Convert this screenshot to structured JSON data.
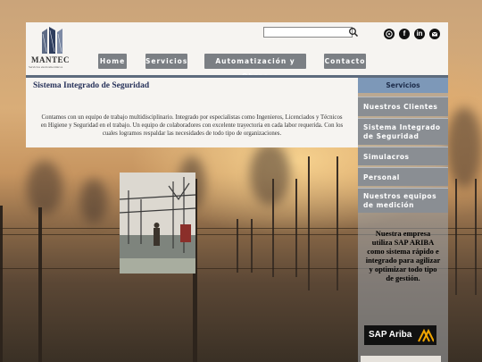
{
  "brand": {
    "name": "MANTEC",
    "tagline": "Servicios electromecánicos"
  },
  "search": {
    "placeholder": "",
    "value": ""
  },
  "social": [
    "whatsapp-icon",
    "facebook-icon",
    "linkedin-icon",
    "mail-icon"
  ],
  "nav": {
    "home": "Home",
    "services": "Servicios",
    "automation": "Automatización y Obras",
    "contact": "Contacto"
  },
  "main": {
    "title": "Sistema Integrado de Seguridad",
    "body": "Contamos con un equipo de trabajo multidisciplinario. Integrado por especialistas como Ingenieros, Licenciados y Técnicos en Higiene y Seguridad en el trabajo. Un equipo de colaboradores con excelente trayectoria en cada labor requerida. Con los cuales logramos respaldar las necesidades de todo tipo de organizaciones."
  },
  "sidebar": {
    "heading": "Servicios",
    "items": [
      "Nuestros Clientes",
      "Sistema Integrado de Seguridad",
      "Simulacros",
      "Personal Capacitado",
      "Nuestros equipos de medición"
    ],
    "promo": "Nuestra empresa utiliza SAP ARIBA como sistema rápido e integrado para agilizar y optimizar todo tipo de gestión.",
    "badge": "SAP Ariba"
  },
  "colors": {
    "nav_button": "#7b7f84",
    "sidebar_heading": "#7d98b8",
    "title_text": "#27325a"
  }
}
